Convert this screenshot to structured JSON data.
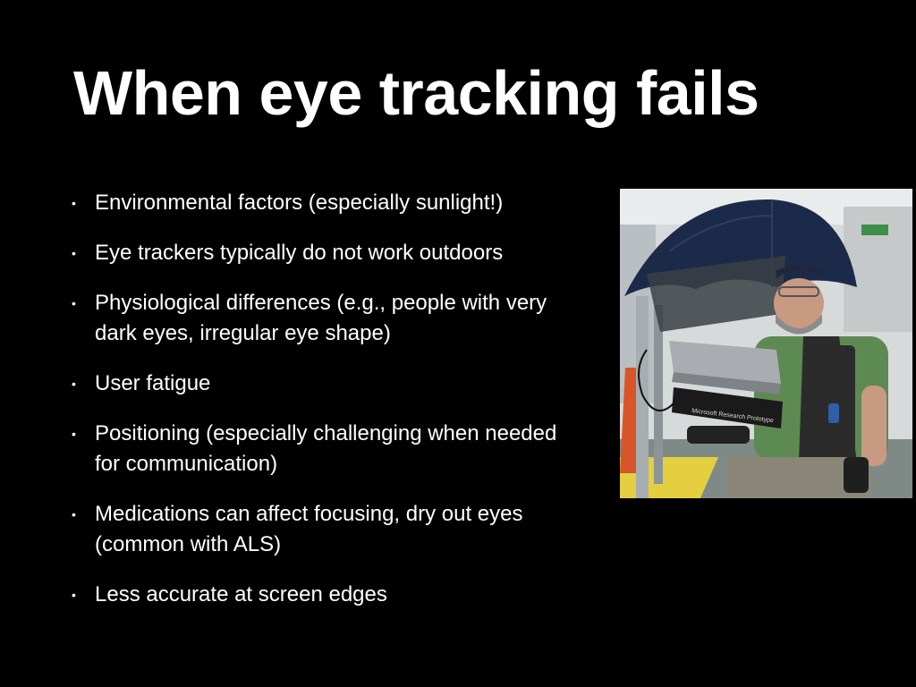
{
  "slide": {
    "title": "When eye tracking fails",
    "bullet_glyph": "•",
    "bullets": [
      "Environmental factors (especially sunlight!)",
      "Eye trackers typically do not work outdoors",
      "Physiological differences (e.g., people with very dark eyes, irregular eye shape)",
      "User fatigue",
      "Positioning (especially challenging when needed for communication)",
      "Medications can affect focusing, dry out eyes (common with ALS)",
      "Less accurate at screen edges"
    ]
  },
  "photo": {
    "device_label": "Microsoft Research Prototype"
  },
  "colors": {
    "background": "#000000",
    "text": "#ffffff",
    "umbrella": "#1c2a4a",
    "shirt": "#5d8a52",
    "vest": "#2b2b2b"
  }
}
